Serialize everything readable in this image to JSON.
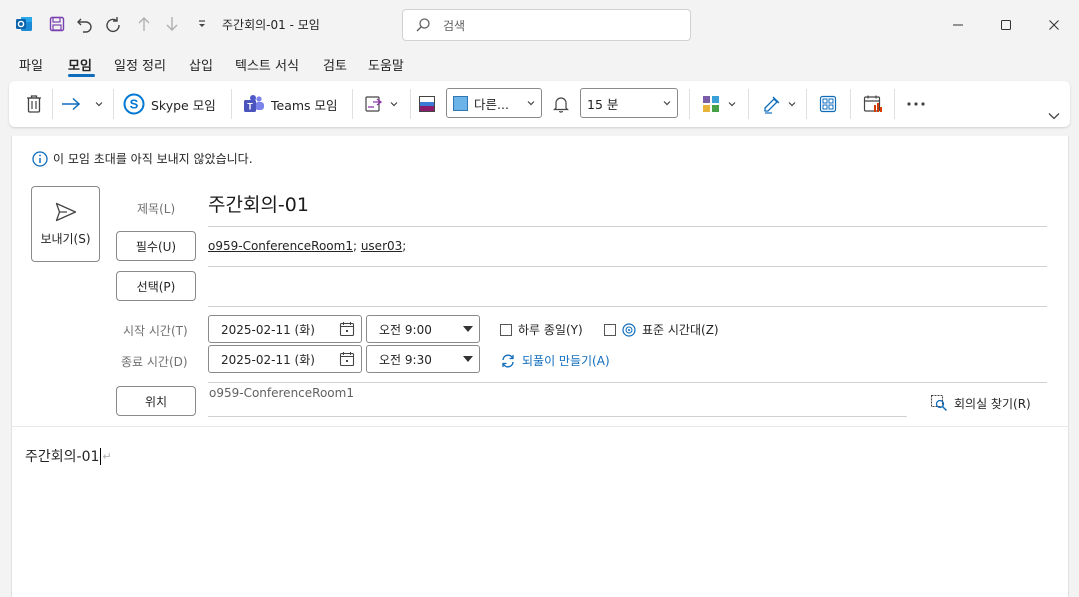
{
  "window": {
    "title": "주간회의-01  -  모임",
    "search_placeholder": "검색"
  },
  "menu": {
    "tabs": [
      {
        "label": "파일",
        "active": false
      },
      {
        "label": "모임",
        "active": true
      },
      {
        "label": "일정 정리",
        "active": false
      },
      {
        "label": "삽입",
        "active": false
      },
      {
        "label": "텍스트 서식",
        "active": false
      },
      {
        "label": "검토",
        "active": false
      },
      {
        "label": "도움말",
        "active": false
      }
    ]
  },
  "ribbon": {
    "skype_label": "Skype 모임",
    "teams_label": "Teams 모임",
    "show_as_value": "다른...",
    "reminder_value": "15 분"
  },
  "form": {
    "info_text": "이 모임 초대를 아직 보내지 않았습니다.",
    "send_label": "보내기(S)",
    "subject_label": "제목(L)",
    "subject_value": "주간회의-01",
    "required_label": "필수(U)",
    "required_attendees": [
      "o959-ConferenceRoom1",
      "user03"
    ],
    "optional_label": "선택(P)",
    "start_label": "시작 시간(T)",
    "start_date": "2025-02-11 (화)",
    "start_time": "오전 9:00",
    "end_label": "종료 시간(D)",
    "end_date": "2025-02-11 (화)",
    "end_time": "오전 9:30",
    "all_day_label": "하루 종일(Y)",
    "all_day_checked": false,
    "timezone_label": "표준 시간대(Z)",
    "timezone_checked": false,
    "recurrence_label": "되풀이 만들기(A)",
    "location_button_label": "위치",
    "location_value": "o959-ConferenceRoom1",
    "room_finder_label": "회의실 찾기(R)"
  },
  "body": {
    "text": "주간회의-01"
  },
  "colors": {
    "accent": "#0f6cbd",
    "show_as_swatch": "#6cb4e8"
  }
}
